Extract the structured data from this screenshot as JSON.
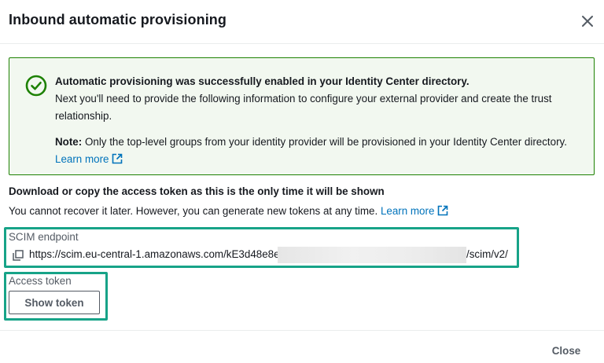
{
  "modal": {
    "title": "Inbound automatic provisioning",
    "close_icon": "close-icon"
  },
  "alert": {
    "type": "success",
    "icon": "check-circle-icon",
    "headline": "Automatic provisioning was successfully enabled in your Identity Center directory.",
    "body": "Next you'll need to provide the following information to configure your external provider and create the trust relationship.",
    "note_label": "Note:",
    "note_text": "Only the top-level groups from your identity provider will be provisioned in your Identity Center directory.",
    "learn_more": "Learn more"
  },
  "token_section": {
    "heading": "Download or copy the access token as this is the only time it will be shown",
    "description": "You cannot recover it later. However, you can generate new tokens at any time.",
    "learn_more": "Learn more"
  },
  "scim": {
    "label": "SCIM endpoint",
    "url_visible": "https://scim.eu-central-1.amazonaws.com/kE3d48e8e15",
    "url_suffix": "/scim/v2/",
    "copy_icon": "copy-icon"
  },
  "access_token": {
    "label": "Access token",
    "button": "Show token"
  },
  "footer": {
    "close": "Close"
  },
  "colors": {
    "success": "#1d8102",
    "success_bg": "#f2f8f0",
    "link": "#0073bb",
    "highlight": "#17a388",
    "text": "#16191f",
    "secondary_text": "#545b64"
  }
}
